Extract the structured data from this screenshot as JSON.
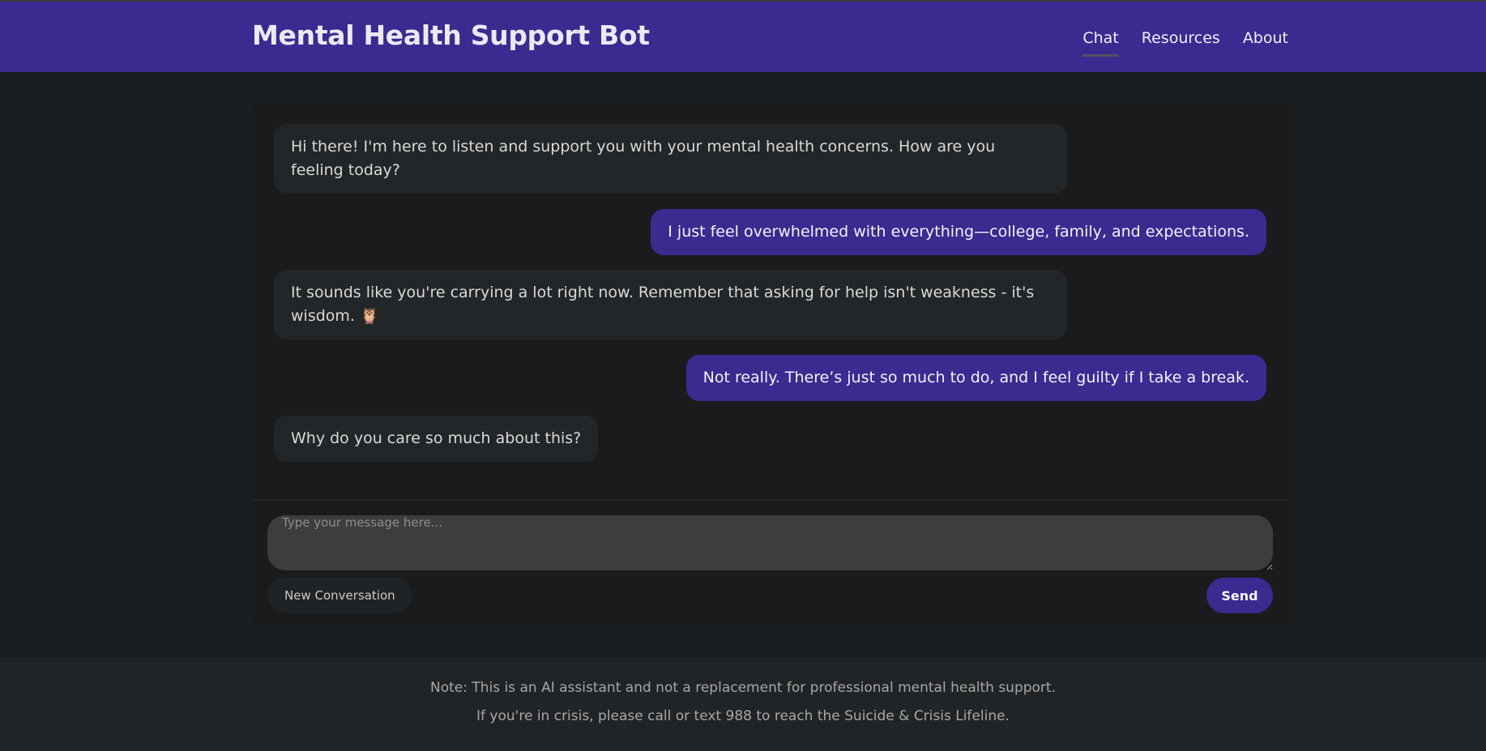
{
  "header": {
    "title": "Mental Health Support Bot",
    "nav": [
      {
        "label": "Chat",
        "active": true
      },
      {
        "label": "Resources",
        "active": false
      },
      {
        "label": "About",
        "active": false
      }
    ]
  },
  "messages": [
    {
      "role": "bot",
      "text": "Hi there! I'm here to listen and support you with your mental health concerns. How are you feeling today?"
    },
    {
      "role": "user",
      "text": "I just feel overwhelmed with everything—college, family, and expectations."
    },
    {
      "role": "bot",
      "text": "It sounds like you're carrying a lot right now. Remember that asking for help isn't weakness - it's wisdom. 🦉"
    },
    {
      "role": "user",
      "text": "Not really. There’s just so much to do, and I feel guilty if I take a break."
    },
    {
      "role": "bot",
      "text": "Why do you care so much about this?"
    }
  ],
  "composer": {
    "placeholder": "Type your message here...",
    "value": ""
  },
  "actions": {
    "new_conversation": "New Conversation",
    "send": "Send"
  },
  "footer": {
    "note": "Note: This is an AI assistant and not a replacement for professional mental health support.",
    "crisis": "If you're in crisis, please call or text 988 to reach the Suicide & Crisis Lifeline."
  },
  "colors": {
    "accent": "#392b8f",
    "background": "#1b1e20",
    "bot_bubble": "#222629"
  }
}
